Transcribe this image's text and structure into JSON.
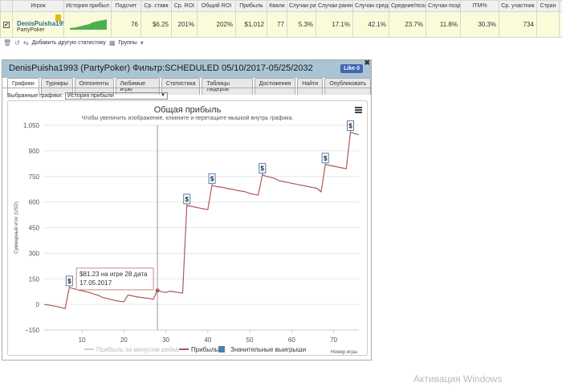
{
  "table": {
    "headers": [
      "Игрок",
      "История прибыл",
      "Подсчет",
      "Ср. ставк",
      "Ср. ROI",
      "Общий ROI",
      "Прибыль",
      "Квали",
      "Случаи ра",
      "Случаи ранне",
      "Случаи средн",
      "Средние/поза",
      "Случаи позд",
      "ITM%",
      "Ср. участник",
      "Стран",
      ""
    ],
    "row": {
      "player_name": "DenisPuisha1993",
      "player_site": "PartyPoker",
      "count": "76",
      "avg_stake": "$6.25",
      "avg_roi": "201%",
      "total_roi": "202%",
      "profit": "$1,012",
      "quali": "77",
      "c1": "5.3%",
      "c2": "17.1%",
      "c3": "42.1%",
      "c4": "23.7%",
      "c5": "11.8%",
      "itm": "30.3%",
      "avg_entrants": "734",
      "more": "y"
    }
  },
  "toolbar": {
    "add_stats": "Добавить другую статистику",
    "groups": "Группы"
  },
  "panel": {
    "title": "DenisPuisha1993 (PartyPoker) Фильтр:SCHEDULED 05/10/2017-05/25/2032",
    "like_label": "Like 0",
    "tabs": [
      "Графики",
      "Турниры",
      "Оппоненты",
      "Любимые игры",
      "Статистика",
      "Таблицы лидеров",
      "Достижения",
      "Найти",
      "Опубликовать"
    ],
    "select_label": "Выбранные графики:",
    "select_value": "История прибыли"
  },
  "chart_data": {
    "type": "line",
    "title": "Общая прибыль",
    "subtitle": "Чтобы увеличить изображение, кликните и перетащите мышкой внутрь графика.",
    "ylabel": "Суммарный итог (USD)",
    "xlabel": "Номер игры",
    "xlim": [
      1,
      76
    ],
    "ylim": [
      -150,
      1050
    ],
    "x_ticks": [
      10,
      20,
      30,
      40,
      50,
      60,
      70
    ],
    "y_ticks": [
      -150,
      0,
      150,
      300,
      450,
      600,
      750,
      900,
      1050
    ],
    "y_tick_labels": [
      "−150",
      "0",
      "150",
      "300",
      "450",
      "600",
      "750",
      "900",
      "1,050"
    ],
    "series": [
      {
        "name": "Прибыль",
        "color": "#b05757",
        "x": [
          1,
          2,
          3,
          4,
          5,
          6,
          7,
          8,
          9,
          10,
          11,
          12,
          13,
          14,
          15,
          16,
          17,
          18,
          19,
          20,
          21,
          22,
          23,
          24,
          25,
          26,
          27,
          28,
          29,
          30,
          31,
          32,
          33,
          34,
          35,
          36,
          37,
          38,
          39,
          40,
          41,
          42,
          43,
          44,
          45,
          46,
          47,
          48,
          49,
          50,
          51,
          52,
          53,
          54,
          55,
          56,
          57,
          58,
          59,
          60,
          61,
          62,
          63,
          64,
          65,
          66,
          67,
          68,
          69,
          70,
          71,
          72,
          73,
          74,
          75,
          76
        ],
        "y": [
          0,
          -3,
          -8,
          -12,
          -18,
          -25,
          100,
          92,
          85,
          80,
          75,
          68,
          60,
          52,
          40,
          35,
          28,
          22,
          18,
          15,
          55,
          50,
          45,
          41,
          38,
          35,
          30,
          81,
          75,
          70,
          78,
          74,
          70,
          66,
          580,
          575,
          570,
          565,
          560,
          555,
          700,
          690,
          688,
          684,
          678,
          674,
          668,
          664,
          660,
          650,
          645,
          640,
          760,
          750,
          745,
          738,
          725,
          720,
          715,
          710,
          705,
          700,
          695,
          690,
          685,
          680,
          660,
          820,
          815,
          810,
          805,
          800,
          795,
          1010,
          1000,
          995
        ]
      }
    ],
    "legend": [
      "Прибыль за минусом рейка",
      "Прибыль",
      "Значительные выигрыши"
    ],
    "flags": [
      {
        "x": 7,
        "y": 100,
        "label": "$"
      },
      {
        "x": 35,
        "y": 580,
        "label": "$"
      },
      {
        "x": 41,
        "y": 700,
        "label": "$"
      },
      {
        "x": 53,
        "y": 760,
        "label": "$"
      },
      {
        "x": 68,
        "y": 820,
        "label": "$"
      },
      {
        "x": 74,
        "y": 1010,
        "label": "$"
      }
    ],
    "tooltip": {
      "line1": "$81.23 на игре 28 дата",
      "line2": "17.05.2017",
      "x": 28
    },
    "grid": true,
    "legend_position": "bottom"
  },
  "watermark": "Активация Windows"
}
